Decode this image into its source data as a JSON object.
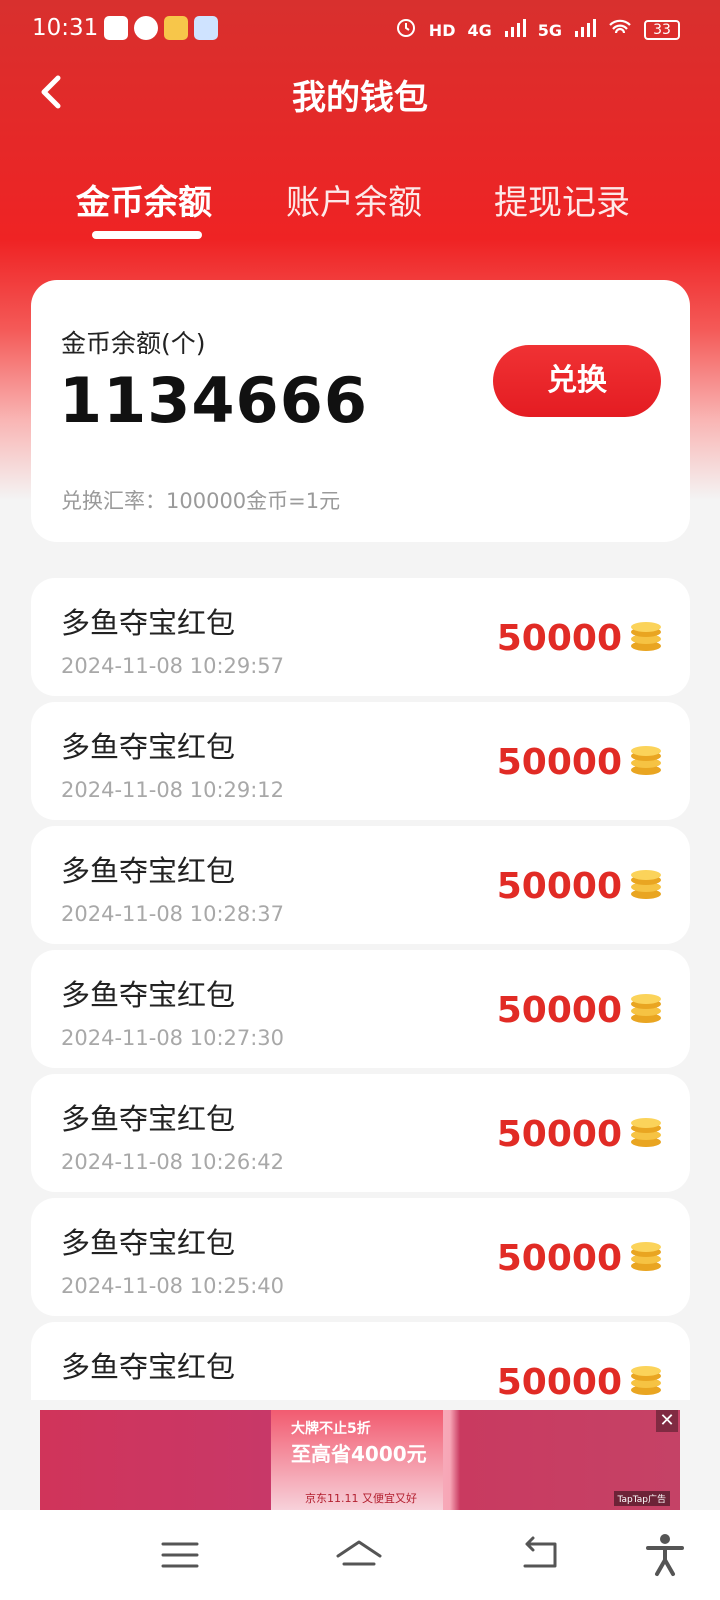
{
  "status_bar": {
    "time": "10:31",
    "battery": "33",
    "network_labels": [
      "HD",
      "4G",
      "5G"
    ]
  },
  "header": {
    "title": "我的钱包",
    "back_icon": "chevron-left-icon"
  },
  "tabs": [
    {
      "label": "金币余额",
      "active": true
    },
    {
      "label": "账户余额",
      "active": false
    },
    {
      "label": "提现记录",
      "active": false
    }
  ],
  "balance": {
    "label": "金币余额(个)",
    "value": "1134666",
    "exchange_button": "兑换",
    "rate_text": "兑换汇率：100000金币=1元"
  },
  "records": [
    {
      "title": "多鱼夺宝红包",
      "time": "2024-11-08 10:29:57",
      "amount": "50000"
    },
    {
      "title": "多鱼夺宝红包",
      "time": "2024-11-08 10:29:12",
      "amount": "50000"
    },
    {
      "title": "多鱼夺宝红包",
      "time": "2024-11-08 10:28:37",
      "amount": "50000"
    },
    {
      "title": "多鱼夺宝红包",
      "time": "2024-11-08 10:27:30",
      "amount": "50000"
    },
    {
      "title": "多鱼夺宝红包",
      "time": "2024-11-08 10:26:42",
      "amount": "50000"
    },
    {
      "title": "多鱼夺宝红包",
      "time": "2024-11-08 10:25:40",
      "amount": "50000"
    },
    {
      "title": "多鱼夺宝红包",
      "time": "",
      "amount": "50000"
    }
  ],
  "ad": {
    "headline": "大牌不止5折",
    "subline": "至高省4000元",
    "footer": "京东11.11 又便宜又好",
    "close": "✕",
    "badge": "TapTap广告"
  },
  "nav": {
    "icons": [
      "menu-icon",
      "home-icon",
      "back-icon",
      "accessibility-icon"
    ]
  },
  "colors": {
    "brand_red": "#ef2324",
    "amount_red": "#e12b25",
    "background": "#f4f4f4"
  }
}
